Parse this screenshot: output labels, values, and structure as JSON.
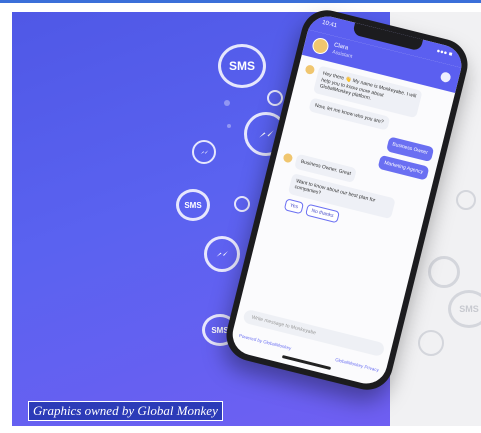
{
  "bubbles": {
    "sms_label": "SMS"
  },
  "caption": "Graphics owned by Global Monkey",
  "phone": {
    "time": "10:41",
    "signal": "●●● ■",
    "header_name": "Clara",
    "header_sub": "Assistant",
    "messages": [
      {
        "from": "bot",
        "text": "Hey there 👋 My name is Monkeyabe. I will help you to know more about GlobalMonkey platform."
      },
      {
        "from": "bot",
        "text": "Now, let me know who you are?"
      },
      {
        "from": "user",
        "text": "Business Owner"
      },
      {
        "from": "user",
        "text": "Marketing Agency"
      },
      {
        "from": "bot",
        "text": "Business Owner. Great"
      },
      {
        "from": "bot",
        "text": "Want to know about our best plan for companies?"
      }
    ],
    "quick_replies": [
      "Yes",
      "No thanks"
    ],
    "input_placeholder": "Write message to Monkeyabe",
    "footer_left": "Powered by GlobalMonkey",
    "footer_right": "GlobalMonkey Privacy"
  },
  "colors": {
    "accent": "#5b5ff0",
    "caption_bg": "#2c3bb8"
  }
}
